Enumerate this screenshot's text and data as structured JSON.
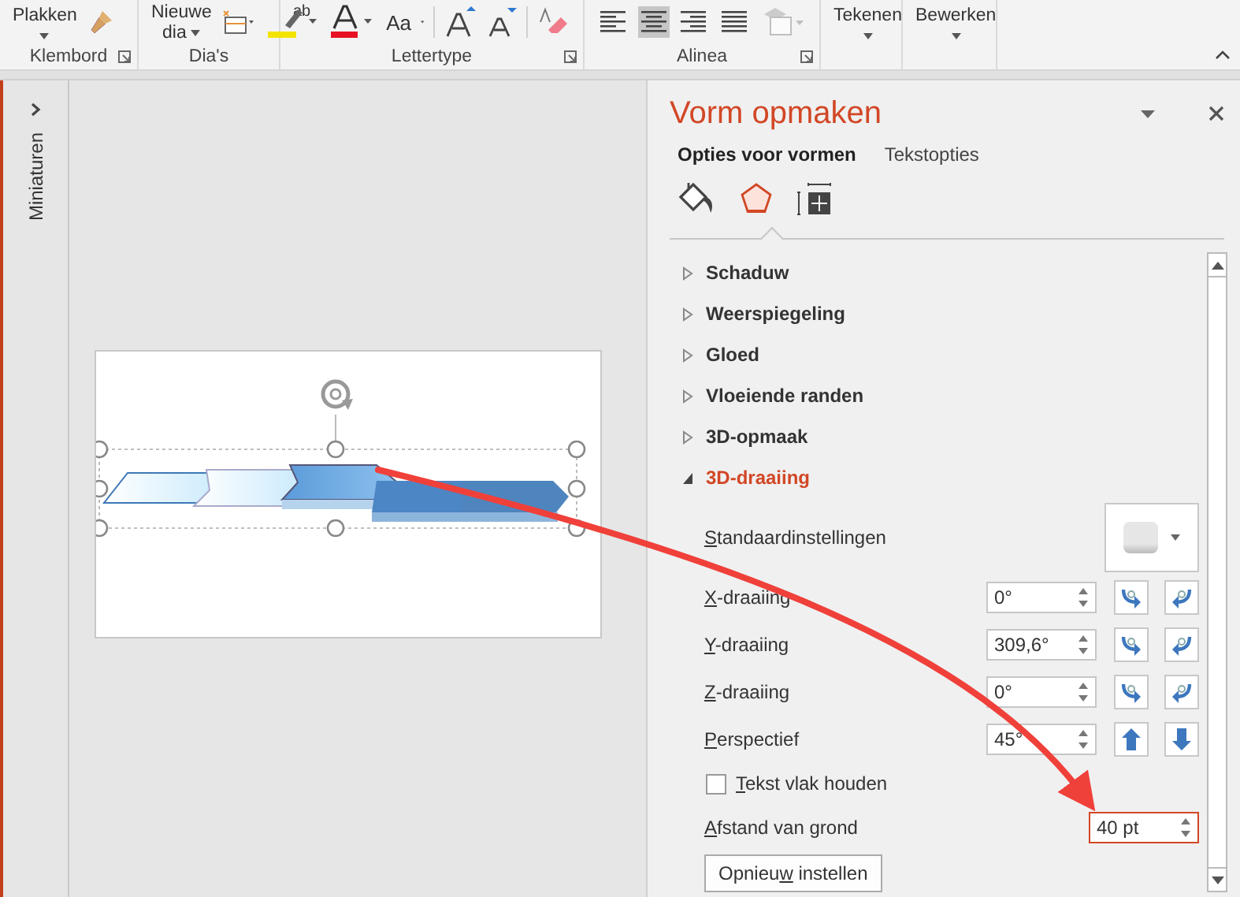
{
  "ribbon": {
    "paste": "Plakken",
    "highlight": "ab",
    "new_slide": [
      "Nieuwe",
      "dia"
    ],
    "case": "Aa",
    "draw": "Tekenen",
    "edit": "Bewerken",
    "groups": [
      {
        "label": "Klembord",
        "launcher": true
      },
      {
        "label": "Dia's",
        "launcher": false
      },
      {
        "label": "Lettertype",
        "launcher": true
      },
      {
        "label": "Alinea",
        "launcher": true
      }
    ],
    "alignment": [
      {
        "selected": false
      },
      {
        "selected": true
      },
      {
        "selected": false
      },
      {
        "selected": false
      }
    ]
  },
  "thumbnails": {
    "label": "Miniaturen",
    "expanded": false
  },
  "pane": {
    "title": "Vorm opmaken",
    "tabs": [
      {
        "label": "Opties voor vormen",
        "selected": true
      },
      {
        "label": "Tekstopties",
        "selected": false
      }
    ],
    "icon_tabs": [
      {
        "selected": false
      },
      {
        "selected": true
      },
      {
        "selected": false
      }
    ],
    "sections": [
      {
        "label": "Schaduw",
        "expanded": false
      },
      {
        "label": "Weerspiegeling",
        "expanded": false
      },
      {
        "label": "Gloed",
        "expanded": false
      },
      {
        "label": "Vloeiende randen",
        "expanded": false
      },
      {
        "label": "3D-opmaak",
        "expanded": false
      },
      {
        "label": "3D-draaiing",
        "expanded": true
      }
    ],
    "rows": [
      {
        "kind": "preset",
        "label": [
          {
            "text": "S",
            "underlined": true
          },
          {
            "text": "tandaardinstellingen",
            "underlined": false
          }
        ]
      },
      {
        "kind": "spin",
        "label": [
          {
            "text": "X",
            "underlined": true
          },
          {
            "text": "-draaiing",
            "underlined": false
          }
        ],
        "value": "0°",
        "highlighted": false
      },
      {
        "kind": "spin",
        "label": [
          {
            "text": "Y",
            "underlined": true
          },
          {
            "text": "-draaiing",
            "underlined": false
          }
        ],
        "value": "309,6°",
        "highlighted": false
      },
      {
        "kind": "spin",
        "label": [
          {
            "text": "Z",
            "underlined": true
          },
          {
            "text": "-draaiing",
            "underlined": false
          }
        ],
        "value": "0°",
        "highlighted": false
      },
      {
        "kind": "spin",
        "label": [
          {
            "text": "P",
            "underlined": true
          },
          {
            "text": "erspectief",
            "underlined": false
          }
        ],
        "value": "45°",
        "highlighted": false
      },
      {
        "kind": "checkbox",
        "label": [
          {
            "text": "T",
            "underlined": true
          },
          {
            "text": "ekst vlak houden",
            "underlined": false
          }
        ],
        "checked": false
      },
      {
        "kind": "field",
        "label": [
          {
            "text": "A",
            "underlined": true
          },
          {
            "text": "fstand van grond",
            "underlined": false
          }
        ],
        "value": "40 pt",
        "highlighted": true
      }
    ],
    "reset_button": {
      "label": [
        {
          "text": "Opnieu",
          "underlined": false
        },
        {
          "text": "w",
          "underlined": true
        },
        {
          "text": " instellen",
          "underlined": false
        }
      ]
    }
  }
}
